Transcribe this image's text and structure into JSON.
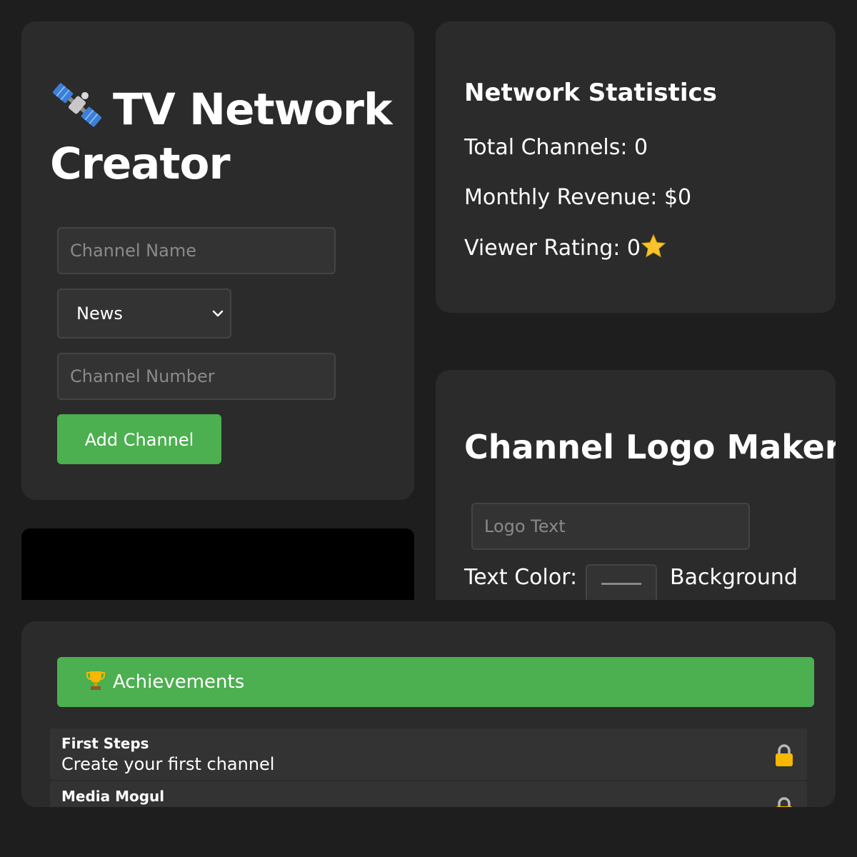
{
  "creator": {
    "title": "TV Network Creator",
    "channel_name_placeholder": "Channel Name",
    "genre_selected": "News",
    "channel_number_placeholder": "Channel Number",
    "add_button_label": "Add Channel"
  },
  "stats": {
    "title": "Network Statistics",
    "total_channels": "Total Channels: 0",
    "monthly_revenue": "Monthly Revenue: $0",
    "viewer_rating": "Viewer Rating: 0"
  },
  "logo_maker": {
    "title": "Channel Logo Maker",
    "logo_text_placeholder": "Logo Text",
    "text_color_label": "Text Color:",
    "background_label": "Background"
  },
  "achievements": {
    "header": "Achievements",
    "items": [
      {
        "title": "First Steps",
        "description": "Create your first channel"
      },
      {
        "title": "Media Mogul",
        "description": ""
      }
    ]
  },
  "colors": {
    "accent": "#4caf50",
    "panel": "#2b2b2b",
    "background": "#1e1e1e",
    "input": "#333333",
    "lock": "#f5b800",
    "star": "#f7c32e"
  },
  "icons": [
    "satellite-icon",
    "chevron-down-icon",
    "star-icon",
    "trophy-icon",
    "lock-icon"
  ]
}
